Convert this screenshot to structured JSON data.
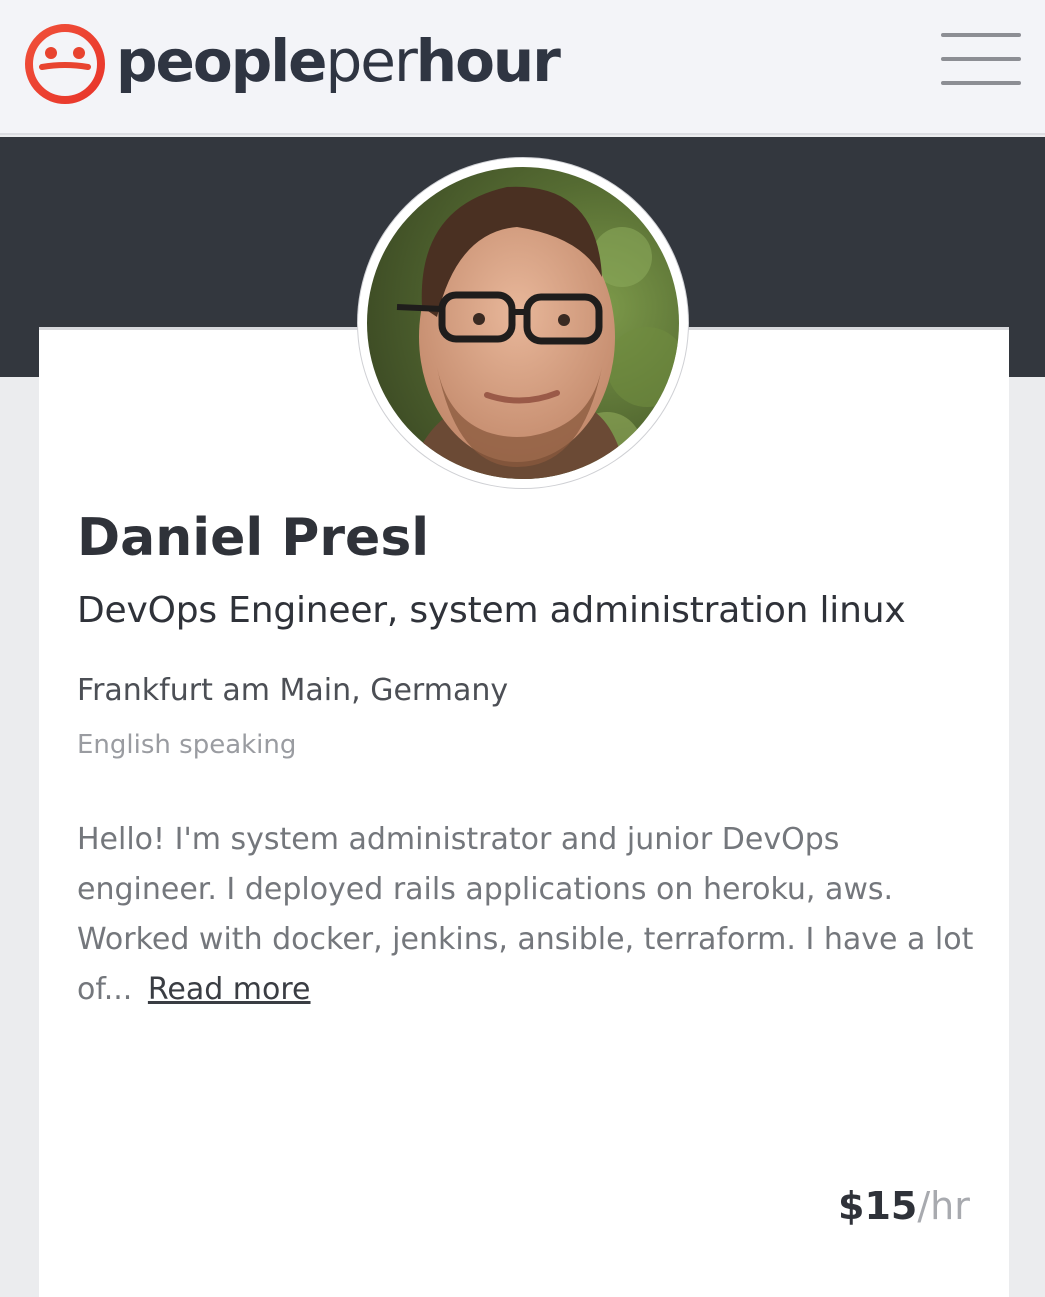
{
  "header": {
    "brand_part1": "people",
    "brand_part2": "per",
    "brand_part3": "hour",
    "logo_icon": "smiley-face-logo-icon",
    "menu_icon": "hamburger-menu-icon",
    "brand_color": "#e8482f"
  },
  "profile": {
    "name": "Daniel Presl",
    "headline": "DevOps Engineer, system administration linux",
    "location": "Frankfurt am Main, Germany",
    "language": "English speaking",
    "bio": "Hello! I'm system administrator and junior DevOps engineer. I deployed rails applications on heroku, aws. Worked with docker, jenkins, ansible, terraform. I have a lot of...",
    "read_more": "Read more",
    "rate_amount": "$15",
    "rate_unit": "/hr"
  }
}
